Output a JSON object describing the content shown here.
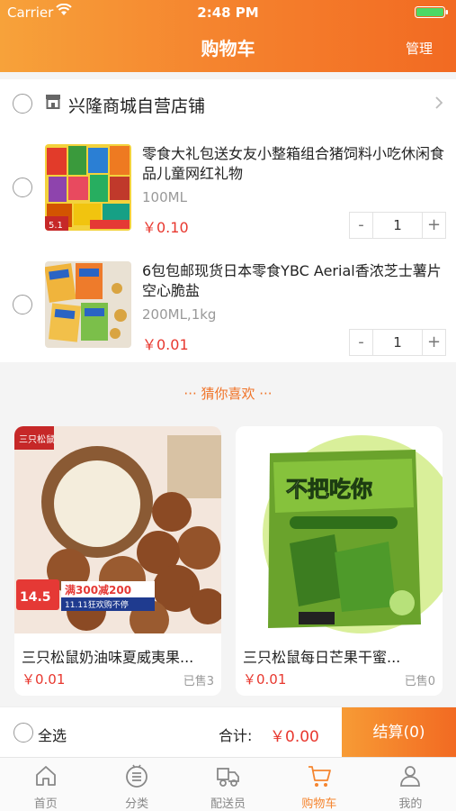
{
  "status": {
    "carrier": "Carrier",
    "time": "2:48 PM"
  },
  "header": {
    "title": "购物车",
    "manage": "管理"
  },
  "store": {
    "name": "兴隆商城自营店铺"
  },
  "cart_items": [
    {
      "title": "零食大礼包送女友小整箱组合猪饲料小吃休闲食品儿童网红礼物",
      "spec": "100ML",
      "price": "￥0.10",
      "qty": "1"
    },
    {
      "title": "6包包邮现货日本零食YBC Aerial香浓芝士薯片空心脆盐",
      "spec": "200ML,1kg",
      "price": "￥0.01",
      "qty": "1"
    }
  ],
  "stepper": {
    "minus": "-",
    "plus": "+"
  },
  "guess": {
    "label": "··· 猜你喜欢 ···"
  },
  "recommend": [
    {
      "title": "三只松鼠奶油味夏威夷果...",
      "price": "￥0.01",
      "sold": "已售3",
      "badge_brand": "三只松鼠",
      "badge_price": "14.5",
      "badge_promo": "满300减200",
      "badge_sub": "11.11狂欢购不停"
    },
    {
      "title": "三只松鼠每日芒果干蜜...",
      "price": "￥0.01",
      "sold": "已售0",
      "badge_brand": "不把吃你"
    }
  ],
  "bottom": {
    "select_all": "全选",
    "total_label": "合计:",
    "total_value": "￥0.00",
    "checkout": "结算(0)"
  },
  "tabs": [
    {
      "label": "首页",
      "icon": "home-icon"
    },
    {
      "label": "分类",
      "icon": "category-icon"
    },
    {
      "label": "配送员",
      "icon": "delivery-icon"
    },
    {
      "label": "购物车",
      "icon": "cart-icon",
      "active": true
    },
    {
      "label": "我的",
      "icon": "profile-icon"
    }
  ],
  "colors": {
    "accent": "#f5852f",
    "price": "#e8382f"
  }
}
